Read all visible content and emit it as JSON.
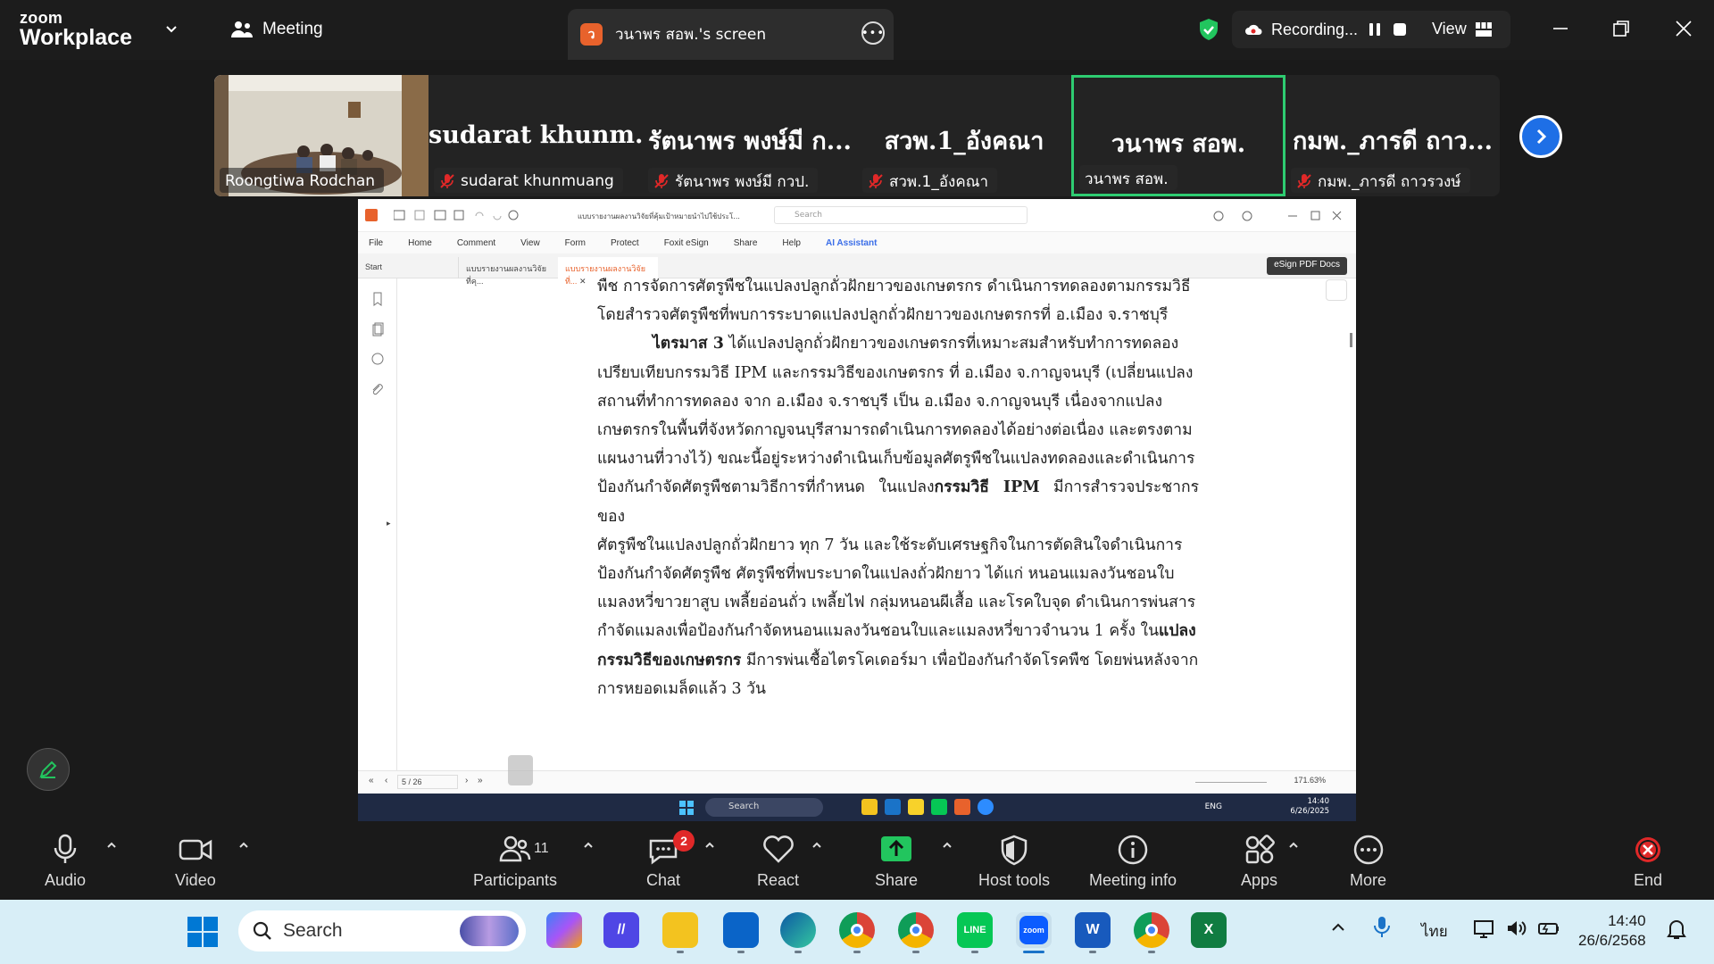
{
  "app": {
    "brand_line1": "zoom",
    "brand_line2": "Workplace",
    "meeting_label": "Meeting"
  },
  "screen_share": {
    "tab_label": "วนาพร สอพ.'s screen",
    "badge_letter": "ว"
  },
  "recording": {
    "label": "Recording...",
    "view_label": "View"
  },
  "participants_strip": [
    {
      "big": "",
      "label": "Roongtiwa Rodchan",
      "muted": false,
      "video": true
    },
    {
      "big": "sudarat  khunm...",
      "label": "sudarat khunmuang",
      "muted": true
    },
    {
      "big": "รัตนาพร พงษ์มี ก...",
      "label": "รัตนาพร พงษ์มี กวป.",
      "muted": true
    },
    {
      "big": "สวพ.1_อังคณา",
      "label": "สวพ.1_อังคณา",
      "muted": true
    },
    {
      "big": "วนาพร สอพ.",
      "label": "วนาพร สอพ.",
      "muted": false,
      "active": true
    },
    {
      "big": "กมพ._ภารดี ถาว...",
      "label": "กมพ._ภารดี ถาวรวงษ์",
      "muted": true
    }
  ],
  "pdf": {
    "doc_title": "แบบรายงานผลงานวิจัยที่คุ้มเป้าหมายนำไปใช้ประโ...",
    "search_placeholder": "Search",
    "menu": [
      "File",
      "Home",
      "Comment",
      "View",
      "Form",
      "Protect",
      "Foxit eSign",
      "Share",
      "Help",
      "AI Assistant"
    ],
    "tabs": [
      "Start",
      "แบบรายงานผลงานวิจัยที่คุ...",
      "แบบรายงานผลงานวิจัยที่..."
    ],
    "esign_label": "eSign PDF Docs",
    "page_indicator": "5 / 26",
    "zoom_level": "171.63%",
    "lines": [
      "พืช การจัดการศัตรูพืชในแปลงปลูกถั่วฝักยาวของเกษตรกร ดำเนินการทดลองตามกรรมวิธี",
      "โดยสำรวจศัตรูพืชที่พบการระบาดแปลงปลูกถั่วฝักยาวของเกษตรกรที่ อ.เมือง จ.ราชบุรี"
    ],
    "para_lead": "ไตรมาส 3",
    "para_lines": [
      " ได้แปลงปลูกถั่วฝักยาวของเกษตรกรที่เหมาะสมสำหรับทำการทดลอง",
      "เปรียบเทียบกรรมวิธี IPM และกรรมวิธีของเกษตรกร ที่ อ.เมือง จ.กาญจนบุรี (เปลี่ยนแปลง",
      "สถานที่ทำการทดลอง จาก อ.เมือง จ.ราชบุรี เป็น อ.เมือง จ.กาญจนบุรี เนื่องจากแปลง",
      "เกษตรกรในพื้นที่จังหวัดกาญจนบุรีสามารถดำเนินการทดลองได้อย่างต่อเนื่อง และตรงตาม",
      "แผนงานที่วางไว้) ขณะนี้อยู่ระหว่างดำเนินเก็บข้อมูลศัตรูพืชในแปลงทดลองและดำเนินการ"
    ],
    "line_ipm_pre": "ป้องกันกำจัดศัตรูพืชตามวิธีการที่กำหนด ในแปลง",
    "line_ipm_bold": "กรรมวิธี IPM",
    "line_ipm_post": " มีการสำรวจประชากรของ",
    "mid_lines": [
      "ศัตรูพืชในแปลงปลูกถั่วฝักยาว ทุก 7 วัน และใช้ระดับเศรษฐกิจในการตัดสินใจดำเนินการ",
      "ป้องกันกำจัดศัตรูพืช ศัตรูพืชที่พบระบาดในแปลงถั่วฝักยาว ได้แก่ หนอนแมลงวันชอนใบ",
      "แมลงหวี่ขาวยาสูบ เพลี้ยอ่อนถั่ว เพลี้ยไฟ กลุ่มหนอนผีเสื้อ และโรคใบจุด ดำเนินการพ่นสาร"
    ],
    "line_farmer_pre": "กำจัดแมลงเพื่อป้องกันกำจัดหนอนแมลงวันชอนใบและแมลงหวี่ขาวจำนวน 1 ครั้ง ใน",
    "line_farmer_bold": "แปลง",
    "line_farmer2_bold": "กรรมวิธีของเกษตรกร",
    "line_farmer2_post": " มีการพ่นเชื้อไตรโคเดอร์มา เพื่อป้องกันกำจัดโรคพืช โดยพ่นหลังจาก",
    "last_line": "การหยอดเมล็ดแล้ว 3 วัน",
    "inner_taskbar": {
      "search": "Search",
      "lang": "ENG",
      "time": "14:40",
      "date": "6/26/2025"
    }
  },
  "controls": {
    "audio": "Audio",
    "video": "Video",
    "participants": "Participants",
    "participants_count": "11",
    "chat": "Chat",
    "chat_badge": "2",
    "react": "React",
    "share": "Share",
    "host_tools": "Host tools",
    "meeting_info": "Meeting info",
    "apps": "Apps",
    "more": "More",
    "end": "End"
  },
  "taskbar": {
    "search_label": "Search",
    "language": "ไทย",
    "time": "14:40",
    "date": "26/6/2568",
    "apps": [
      "copilot-icon",
      "teams-icon",
      "file-explorer-icon",
      "outlook-icon",
      "edge-icon",
      "chrome-icon",
      "chrome-profile-icon",
      "line-icon",
      "zoom-icon",
      "word-icon",
      "chrome-icon-2",
      "excel-icon"
    ]
  },
  "colors": {
    "zoom_blue": "#1e6fe6",
    "active_green": "#2ecc71",
    "share_green": "#22c55e",
    "end_red": "#e02828",
    "foxit_orange": "#e8622c"
  }
}
